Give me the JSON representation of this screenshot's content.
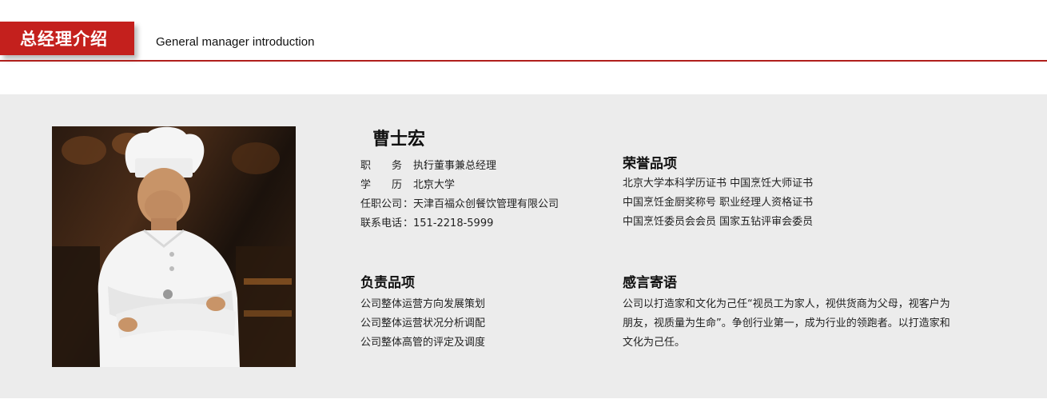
{
  "header": {
    "title": "总经理介绍",
    "subtitle": "General manager introduction",
    "accent_color": "#c4201d"
  },
  "profile": {
    "photo_icon": "chef-portrait-photo",
    "name": "曹士宏",
    "info": [
      {
        "label": "职务",
        "separator": "：",
        "value": "执行董事兼总经理"
      },
      {
        "label": "学历",
        "separator": "：",
        "value": "北京大学"
      },
      {
        "label": "任职公司",
        "separator": "：",
        "value": "天津百福众创餐饮管理有限公司"
      },
      {
        "label": "联系电话",
        "separator": "：",
        "value": "151-2218-5999"
      }
    ]
  },
  "honors": {
    "title": "荣誉品项",
    "items": [
      "北京大学本科学历证书 中国烹饪大师证书",
      "中国烹饪金厨奖称号 职业经理人资格证书",
      "中国烹饪委员会会员 国家五钻评审会委员"
    ]
  },
  "duties": {
    "title": "负责品项",
    "items": [
      "公司整体运营方向发展策划",
      "公司整体运营状况分析调配",
      "公司整体高管的评定及调度"
    ]
  },
  "motto": {
    "title": "感言寄语",
    "text": "公司以打造家和文化为己任“视员工为家人，视供货商为父母，视客户为朋友，视质量为生命”。争创行业第一，成为行业的领跑者。以打造家和文化为己任。"
  }
}
